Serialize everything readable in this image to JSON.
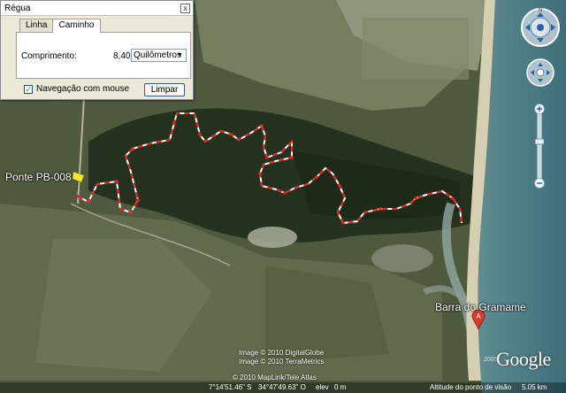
{
  "dialog": {
    "title": "Régua",
    "close_label": "x",
    "tabs": [
      {
        "label": "Linha",
        "active": false
      },
      {
        "label": "Caminho",
        "active": true
      }
    ],
    "length_label": "Comprimento:",
    "length_value": "8,40",
    "unit": "Quilômetros",
    "nav_checkbox_label": "Navegação com mouse",
    "nav_checked": true,
    "clear_label": "Limpar"
  },
  "places": {
    "bridge_label": "Ponte PB-008",
    "beach_label": "Barra do Gramame"
  },
  "attribution": {
    "line1": "Image © 2010 DigitalGlobe",
    "line2": "Image © 2010 TerraMetrics",
    "line3": "© 2010 MapLink/Tele Atlas",
    "year": "2005",
    "logo": "Google"
  },
  "status": {
    "lat": "7°14'51.46\" S",
    "lon": "34°47'49.63\" O",
    "elev_label": "elev",
    "elev_value": "0 m",
    "eye_label": "Altitude do ponto de visão",
    "eye_value": "5.05 km"
  },
  "icons": {
    "pushpin": "yellow-pushpin-icon",
    "marker": "red-placemark-icon",
    "look": "look-joystick-icon",
    "move": "move-joystick-icon",
    "zoom_in": "zoom-in-icon",
    "zoom_out": "zoom-out-icon"
  },
  "colors": {
    "path_main": "#e82020",
    "path_alt": "#ffffff",
    "dialog_bg": "#ece9d8",
    "marker": "#d93b2b",
    "pushpin": "#f2e83a"
  }
}
